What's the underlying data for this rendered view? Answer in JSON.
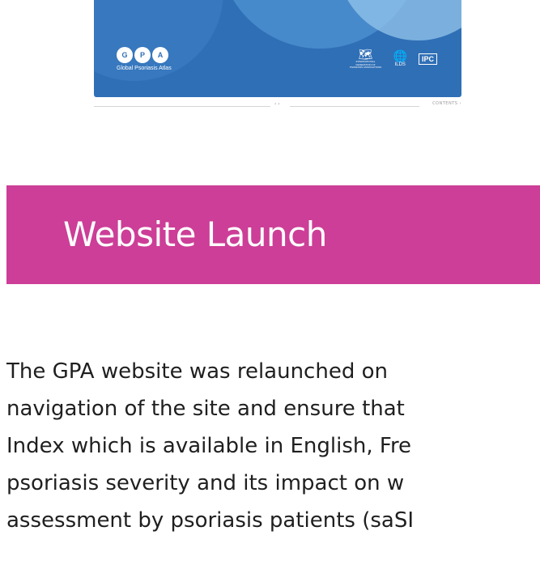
{
  "cover": {
    "gpa_letters": [
      "G",
      "P",
      "A"
    ],
    "gpa_caption": "Global Psoriasis Atlas",
    "partners": [
      {
        "icon": "world-map-icon",
        "label": "INTERNATIONAL FEDERATION OF PSORIASIS ASSOCIATIONS"
      },
      {
        "icon": "globe-icon",
        "label": "ILDS"
      },
      {
        "icon": "ipc-logo",
        "label": "IPC"
      }
    ]
  },
  "pager": {
    "nav_label": "‹ ›",
    "contents_label": "CONTENTS ›"
  },
  "section": {
    "title": "Website Launch",
    "color": "#cc3e97"
  },
  "body": {
    "lines": [
      "The GPA website was relaunched on",
      "navigation of the site and ensure that",
      "Index which is available in English, Fre",
      "psoriasis severity and its impact on w",
      "assessment by psoriasis patients (saSI"
    ]
  }
}
